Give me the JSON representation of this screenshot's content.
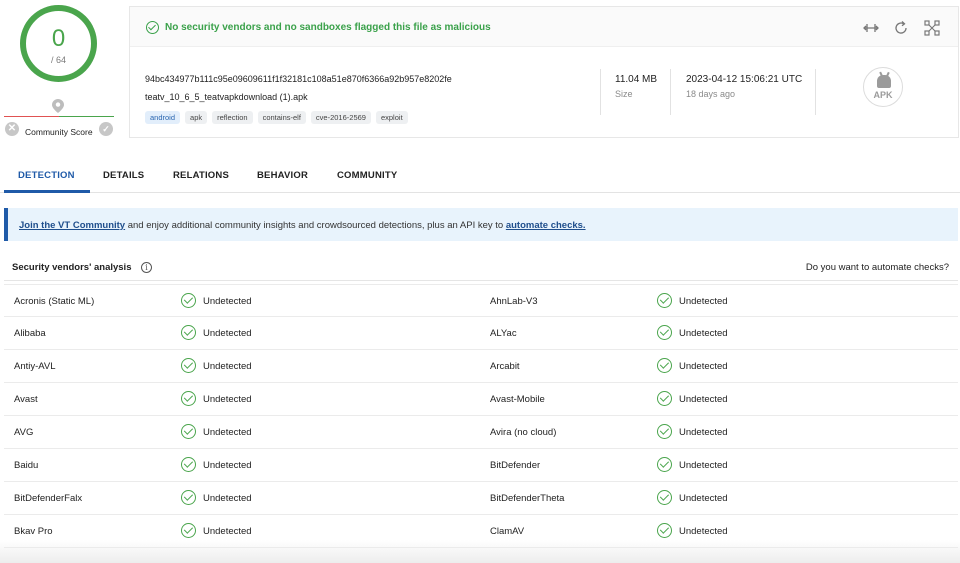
{
  "score": {
    "value": "0",
    "total": "/ 64",
    "community_label": "Community Score"
  },
  "banner": {
    "text": "No security vendors and no sandboxes flagged this file as malicious"
  },
  "file": {
    "hash": "94bc434977b111c95e09609611f1f32181c108a51e870f6366a92b957e8202fe",
    "name": "teatv_10_6_5_teatvapkdownload (1).apk",
    "tags": [
      "android",
      "apk",
      "reflection",
      "contains-elf",
      "cve-2016-2569",
      "exploit"
    ],
    "size_value": "11.04 MB",
    "size_label": "Size",
    "date_value": "2023-04-12 15:06:21 UTC",
    "date_label": "18 days ago",
    "type_label": "APK"
  },
  "tabs": [
    {
      "label": "DETECTION",
      "active": true
    },
    {
      "label": "DETAILS",
      "active": false
    },
    {
      "label": "RELATIONS",
      "active": false
    },
    {
      "label": "BEHAVIOR",
      "active": false
    },
    {
      "label": "COMMUNITY",
      "active": false
    }
  ],
  "community": {
    "link": "Join the VT Community",
    "middle": " and enjoy additional community insights and crowdsourced detections, plus an API key to ",
    "link2": "automate checks."
  },
  "vendors_section": {
    "title": "Security vendors' analysis",
    "automate": "Do you want to automate checks?"
  },
  "vendors": [
    {
      "left": "Acronis (Static ML)",
      "left_status": "Undetected",
      "right": "AhnLab-V3",
      "right_status": "Undetected"
    },
    {
      "left": "Alibaba",
      "left_status": "Undetected",
      "right": "ALYac",
      "right_status": "Undetected"
    },
    {
      "left": "Antiy-AVL",
      "left_status": "Undetected",
      "right": "Arcabit",
      "right_status": "Undetected"
    },
    {
      "left": "Avast",
      "left_status": "Undetected",
      "right": "Avast-Mobile",
      "right_status": "Undetected"
    },
    {
      "left": "AVG",
      "left_status": "Undetected",
      "right": "Avira (no cloud)",
      "right_status": "Undetected"
    },
    {
      "left": "Baidu",
      "left_status": "Undetected",
      "right": "BitDefender",
      "right_status": "Undetected"
    },
    {
      "left": "BitDefenderFalx",
      "left_status": "Undetected",
      "right": "BitDefenderTheta",
      "right_status": "Undetected"
    },
    {
      "left": "Bkav Pro",
      "left_status": "Undetected",
      "right": "ClamAV",
      "right_status": "Undetected"
    }
  ],
  "colors": {
    "clean": "#4aa54c",
    "accent": "#1f5aa8",
    "community_bg": "#e8f3fc"
  }
}
